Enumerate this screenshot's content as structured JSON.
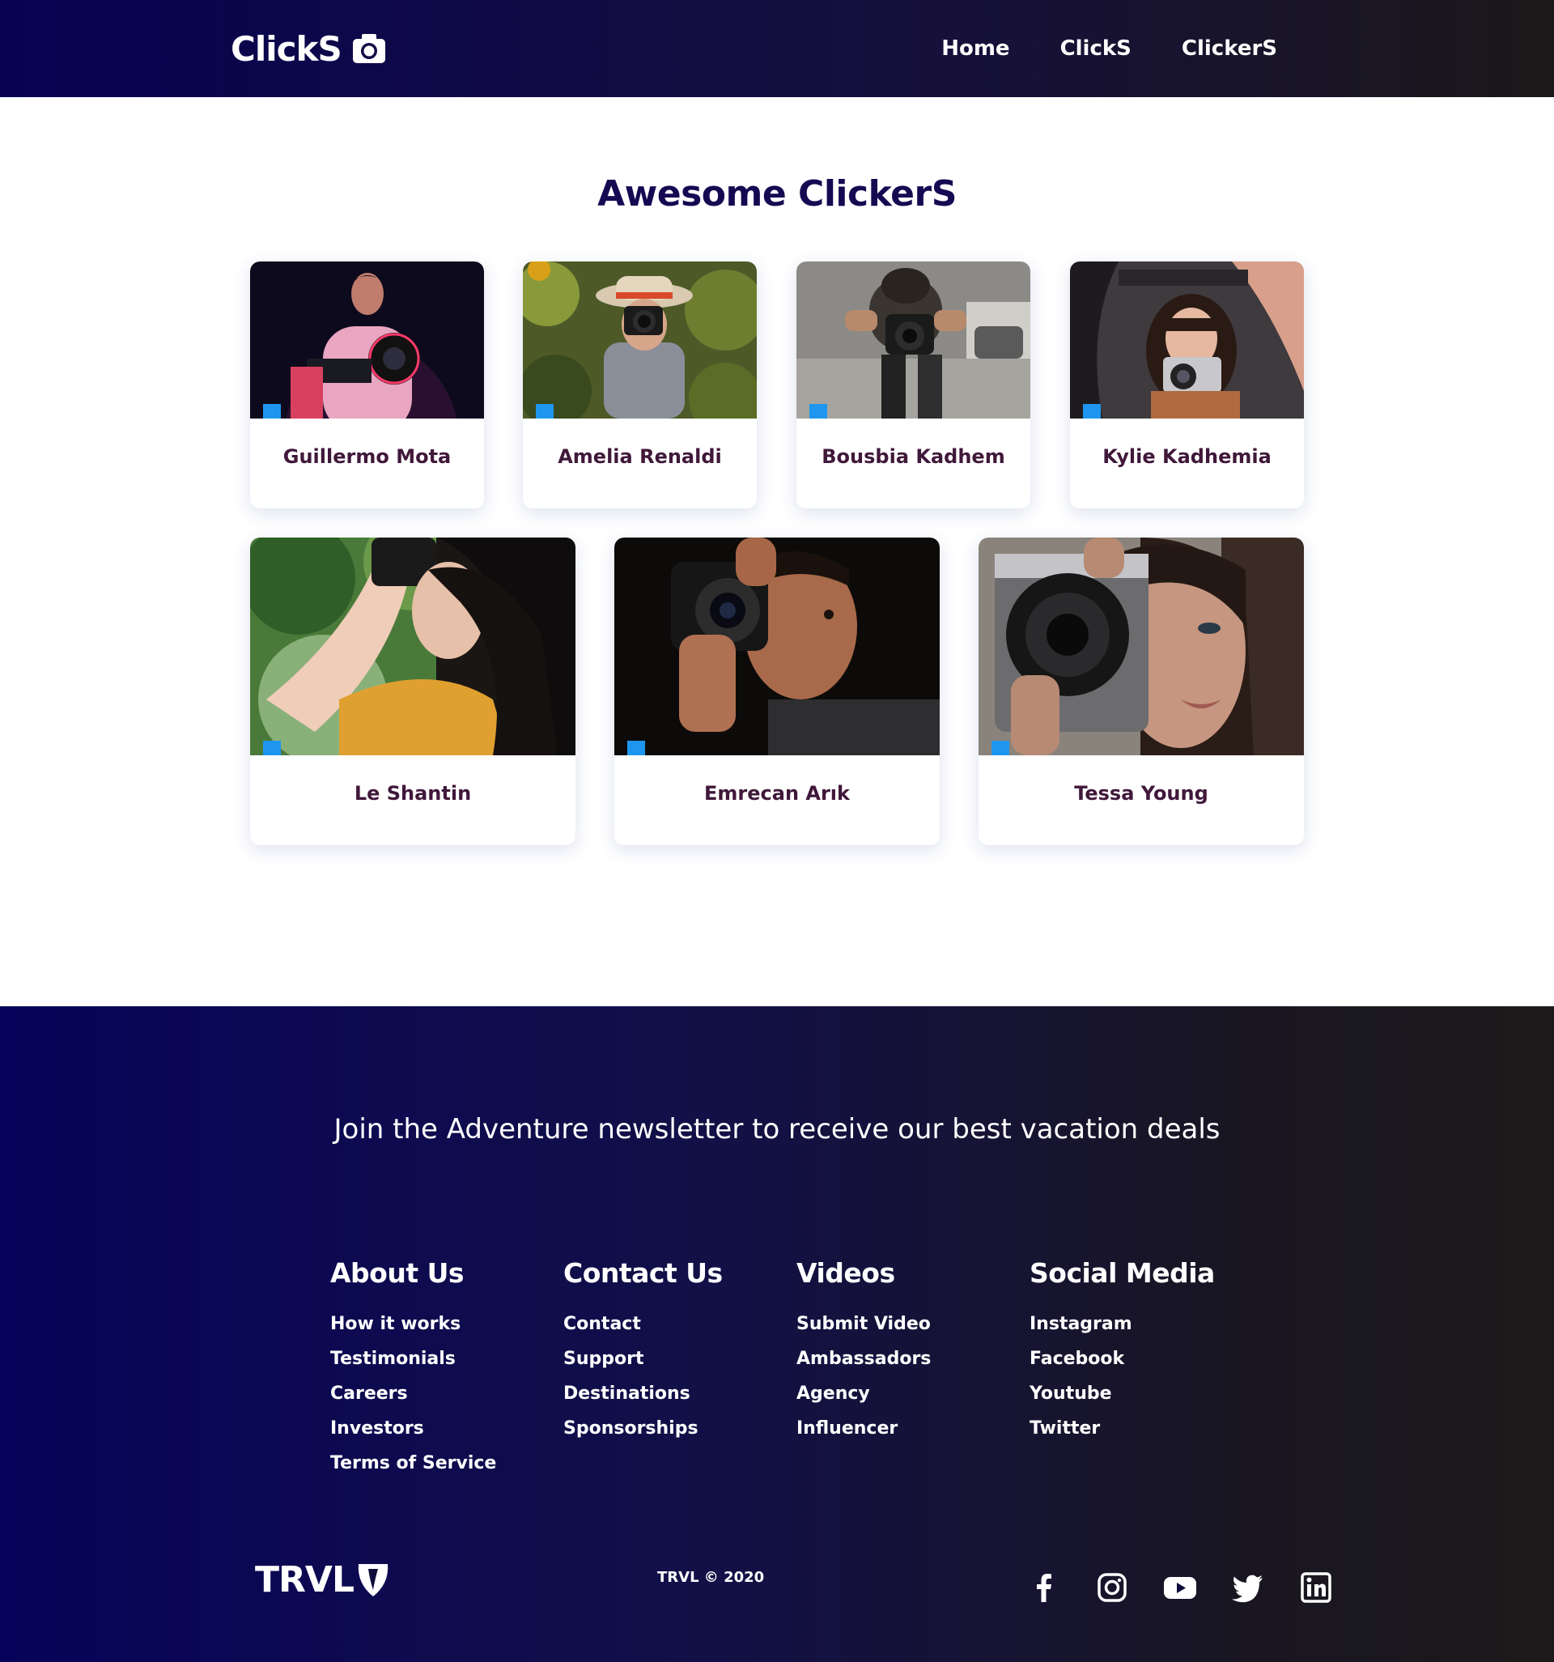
{
  "nav": {
    "logo_text": "ClickS",
    "links": [
      "Home",
      "ClickS",
      "ClickerS"
    ]
  },
  "gallery": {
    "title": "Awesome ClickerS",
    "photographers": [
      "Guillermo Mota",
      "Amelia Renaldi",
      "Bousbia Kadhem",
      "Kylie Kadhemia",
      "Le Shantin",
      "Emrecan Arık",
      "Tessa Young"
    ]
  },
  "footer": {
    "newsletter": "Join the Adventure newsletter to receive our best vacation deals",
    "columns": [
      {
        "title": "About Us",
        "links": [
          "How it works",
          "Testimonials",
          "Careers",
          "Investors",
          "Terms of Service"
        ]
      },
      {
        "title": "Contact Us",
        "links": [
          "Contact",
          "Support",
          "Destinations",
          "Sponsorships"
        ]
      },
      {
        "title": "Videos",
        "links": [
          "Submit Video",
          "Ambassadors",
          "Agency",
          "Influencer"
        ]
      },
      {
        "title": "Social Media",
        "links": [
          "Instagram",
          "Facebook",
          "Youtube",
          "Twitter"
        ]
      }
    ],
    "brand": "TRVL",
    "copyright": "TRVL © 2020",
    "social_icons": [
      "facebook-icon",
      "instagram-icon",
      "youtube-icon",
      "twitter-icon",
      "linkedin-icon"
    ]
  },
  "colors": {
    "nav_gradient_start": "#070352",
    "title": "#150a52",
    "card_name": "#40183a",
    "tag": "#1e96f0",
    "footer_gradient_start": "#07035a",
    "footer_gradient_end": "#1c1a1a"
  }
}
